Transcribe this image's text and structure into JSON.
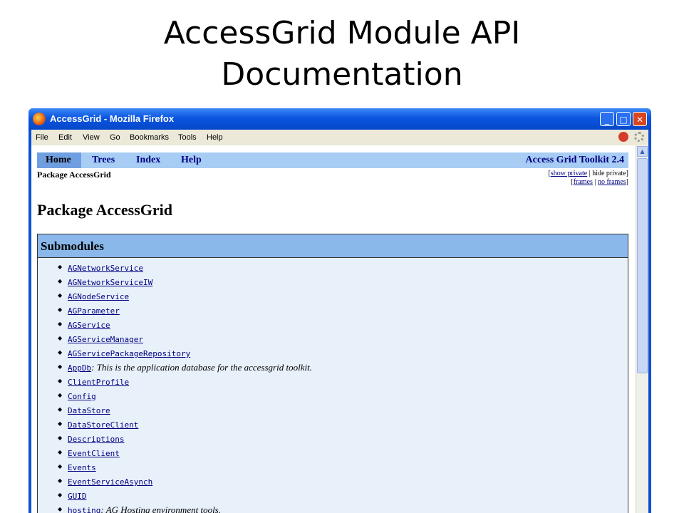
{
  "slide": {
    "title_line1": "AccessGrid Module API",
    "title_line2": "Documentation"
  },
  "window": {
    "title": "AccessGrid - Mozilla Firefox",
    "buttons": {
      "minimize": "_",
      "maximize": "□",
      "close": "✕"
    }
  },
  "menu": {
    "items": [
      "File",
      "Edit",
      "View",
      "Go",
      "Bookmarks",
      "Tools",
      "Help"
    ]
  },
  "nav": {
    "tabs": [
      "Home",
      "Trees",
      "Index",
      "Help"
    ],
    "product": "Access Grid Toolkit 2.4"
  },
  "package_small": "Package AccessGrid",
  "options": {
    "line1": {
      "open": "[",
      "show_private": "show private",
      "sep": " | hide private]"
    },
    "line2": {
      "open": "[",
      "frames": "frames",
      "sep": " | ",
      "no_frames": "no frames",
      "close": "]"
    }
  },
  "page_title": "Package AccessGrid",
  "submodules": {
    "header": "Submodules",
    "items": [
      {
        "name": "AGNetworkService",
        "desc": ""
      },
      {
        "name": "AGNetworkServiceIW",
        "desc": ""
      },
      {
        "name": "AGNodeService",
        "desc": ""
      },
      {
        "name": "AGParameter",
        "desc": ""
      },
      {
        "name": "AGService",
        "desc": ""
      },
      {
        "name": "AGServiceManager",
        "desc": ""
      },
      {
        "name": "AGServicePackageRepository",
        "desc": ""
      },
      {
        "name": "AppDb",
        "desc": ": This is the application database for the accessgrid toolkit."
      },
      {
        "name": "ClientProfile",
        "desc": ""
      },
      {
        "name": "Config",
        "desc": ""
      },
      {
        "name": "DataStore",
        "desc": ""
      },
      {
        "name": "DataStoreClient",
        "desc": ""
      },
      {
        "name": "Descriptions",
        "desc": ""
      },
      {
        "name": "EventClient",
        "desc": ""
      },
      {
        "name": "Events",
        "desc": ""
      },
      {
        "name": "EventServiceAsynch",
        "desc": ""
      },
      {
        "name": "GUID",
        "desc": ""
      },
      {
        "name": "hosting",
        "desc": ": AG Hosting environment tools."
      }
    ]
  }
}
